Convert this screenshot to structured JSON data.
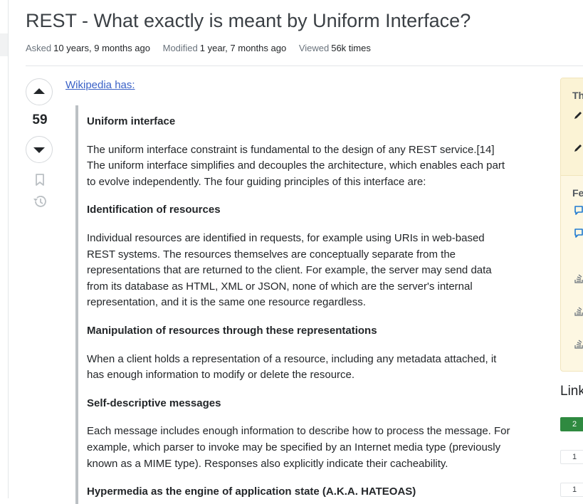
{
  "question": {
    "title": "REST - What exactly is meant by Uniform Interface?",
    "meta": {
      "asked_label": "Asked",
      "asked_value": "10 years, 9 months ago",
      "modified_label": "Modified",
      "modified_value": "1 year, 7 months ago",
      "viewed_label": "Viewed",
      "viewed_value": "56k times"
    },
    "score": "59",
    "intro_link": "Wikipedia has:"
  },
  "quote": {
    "h1": "Uniform interface",
    "p1": "The uniform interface constraint is fundamental to the design of any REST service.[14] The uniform interface simplifies and decouples the architecture, which enables each part to evolve independently. The four guiding principles of this interface are:",
    "h2": "Identification of resources",
    "p2": "Individual resources are identified in requests, for example using URIs in web-based REST systems. The resources themselves are conceptually separate from the representations that are returned to the client. For example, the server may send data from its database as HTML, XML or JSON, none of which are the server's internal representation, and it is the same one resource regardless.",
    "h3": "Manipulation of resources through these representations",
    "p3": "When a client holds a representation of a resource, including any metadata attached, it has enough information to modify or delete the resource.",
    "h4": "Self-descriptive messages",
    "p4": "Each message includes enough information to describe how to process the message. For example, which parser to invoke may be specified by an Internet media type (previously known as a MIME type). Responses also explicitly indicate their cacheability.",
    "h5": "Hypermedia as the engine of application state (A.K.A. HATEOAS)"
  },
  "sidebar": {
    "blog_head_fragment": "Th",
    "featured_head_fragment": "Fe",
    "linked_title_fragment": "Link",
    "linked_counts": [
      "2",
      "1",
      "1"
    ]
  },
  "icons": [
    "arrow-up-icon",
    "arrow-down-icon",
    "bookmark-icon",
    "history-icon",
    "pencil-icon",
    "chat-icon",
    "stack-icon"
  ],
  "colors": {
    "link": "#3b62c7",
    "accepted_green": "#2f8a40",
    "sidebar_yellow": "#fdf7e2",
    "blockquote_bar": "#bbc0c4"
  }
}
